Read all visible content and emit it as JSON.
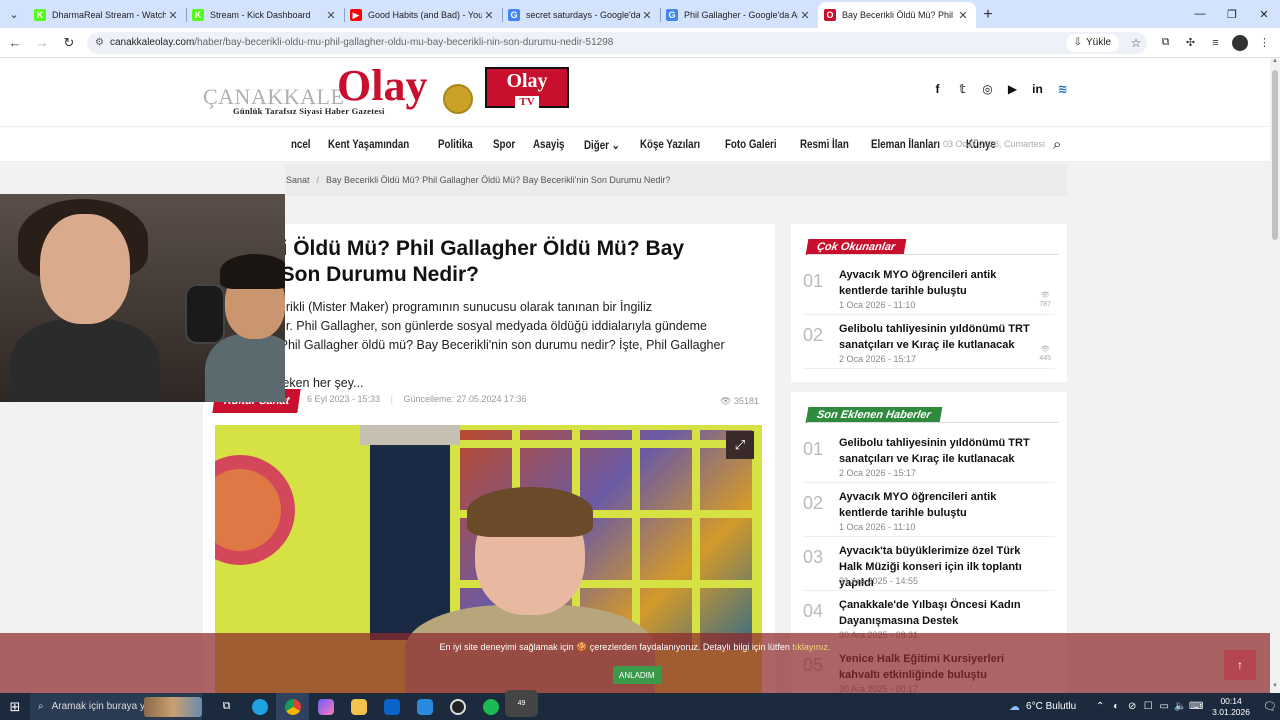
{
  "browser": {
    "tabs": [
      {
        "title": "DharmaReal Stream - Watch Li",
        "favicon_color": "#53fc18",
        "favicon_glyph": "K"
      },
      {
        "title": "Stream - Kick Dashboard",
        "favicon_color": "#53fc18",
        "favicon_glyph": "K"
      },
      {
        "title": "Good Habits (and Bad) - YouTu",
        "favicon_color": "#ff0000",
        "favicon_glyph": "▶"
      },
      {
        "title": "secret saturdays - Google'da Ar",
        "favicon_color": "#4285f4",
        "favicon_glyph": "G"
      },
      {
        "title": "Phil Gallagher - Google'da Ara",
        "favicon_color": "#4285f4",
        "favicon_glyph": "G"
      },
      {
        "title": "Bay Becerikli Öldü Mü? Phil Gal",
        "favicon_color": "#c8102e",
        "favicon_glyph": "O",
        "active": true
      }
    ],
    "url_host": "canakkaleolay.com",
    "url_path": "/haber/bay-becerikli-oldu-mu-phil-gallagher-oldu-mu-bay-becerikli-nin-son-durumu-nedir-51298",
    "install_label": "Yükle"
  },
  "site": {
    "logo_prefix": "ÇANAKKALE",
    "logo_name": "Olay",
    "tagline": "Günlük Tarafsız Siyasi Haber Gazetesi",
    "tv_line1": "Olay",
    "tv_line2": "TV",
    "social": [
      "f",
      "𝕥",
      "◎",
      "▶",
      "in",
      "≋"
    ],
    "nav": [
      "Güncel",
      "Kent Yaşamından",
      "Politika",
      "Spor",
      "Asayiş",
      "Diğer ⌄",
      "Köşe Yazıları",
      "Foto Galeri",
      "Resmi İlan",
      "Eleman İlanları",
      "Künye"
    ],
    "nav_visible": [
      "ncel",
      "Kent Yaşamından",
      "Politika",
      "Spor",
      "Asayiş",
      "Diğer ⌄",
      "Köşe Yazıları",
      "Foto Galeri",
      "Resmi İlan",
      "Eleman İlanları",
      "Künye"
    ],
    "date": "03 Ocak 2026, Cumartesi",
    "breadcrumb": {
      "parent": "Sanat",
      "current": "Bay Becerikli Öldü Mü? Phil Gallagher Öldü Mü? Bay Becerikli'nin Son Durumu Nedir?"
    }
  },
  "article": {
    "title_visible": "ecerikli Öldü Mü? Phil Gallagher Öldü Mü? Bay kli'nin Son Durumu Nedir?",
    "title_line1": "ecerikli Öldü Mü? Phil Gallagher Öldü Mü? Bay",
    "title_line2": "kli'nin Son Durumu Nedir?",
    "lead_line1": "er, Bay Becerikli (Mister Maker) programının sunucusu olarak tanınan bir İngiliz",
    "lead_line2": "ve oyuncudur. Phil Gallagher, son günlerde sosyal medyada öldüğü iddialarıyla gündeme",
    "lead_line3": "geldi. Peki, Phil Gallagher öldü mü? Bay Becerikli'nin son durumu nedir? İşte, Phil Gallagher hakkında",
    "lead_line4": "bilmeniz gereken her şey...",
    "category": "Kültür Sanat",
    "published": "6 Eyl 2023 - 15:33",
    "updated": "Güncelleme: 27.05.2024 17:36",
    "views": "35181"
  },
  "sidebar": {
    "most_read_title": "Çok Okunanlar",
    "most_read": [
      {
        "num": "01",
        "title": "Ayvacık MYO öğrencileri antik kentlerde tarihle buluştu",
        "date": "1 Oca 2026 - 11:10",
        "views": "787"
      },
      {
        "num": "02",
        "title": "Gelibolu tahliyesinin yıldönümü TRT sanatçıları ve Kıraç ile kutlanacak",
        "date": "2 Oca 2026 - 15:17",
        "views": "445"
      }
    ],
    "latest_title": "Son Eklenen Haberler",
    "latest": [
      {
        "num": "01",
        "title": "Gelibolu tahliyesinin yıldönümü TRT sanatçıları ve Kıraç ile kutlanacak",
        "date": "2 Oca 2026 - 15:17"
      },
      {
        "num": "02",
        "title": "Ayvacık MYO öğrencileri antik kentlerde tarihle buluştu",
        "date": "1 Oca 2026 - 11:10"
      },
      {
        "num": "03",
        "title": "Ayvacık'ta büyüklerimize özel Türk Halk Müziği konseri için ilk toplantı yapıldı",
        "date": "31 Ara 2025 - 14:55"
      },
      {
        "num": "04",
        "title": "Çanakkale'de Yılbaşı Öncesi Kadın Dayanışmasına Destek",
        "date": "30 Ara 2025 - 08:31"
      },
      {
        "num": "05",
        "title": "Yenice Halk Eğitimi Kursiyerleri kahvaltı etkinliğinde buluştu",
        "date": "30 Ara 2025 - 00:17"
      }
    ]
  },
  "cookie": {
    "text_before": "En iyi site deneyimi sağlamak için 🍪 çerezlerden faydalanıyoruz. Detaylı bilgi için lütfen ",
    "link": "tıklayınız.",
    "button": "ANLADIM"
  },
  "taskbar": {
    "search_placeholder": "Aramak için buraya yazın",
    "weather": "6°C  Bulutlu",
    "time": "00:14",
    "date": "3.01.2026",
    "whatsapp_badge": "49"
  }
}
